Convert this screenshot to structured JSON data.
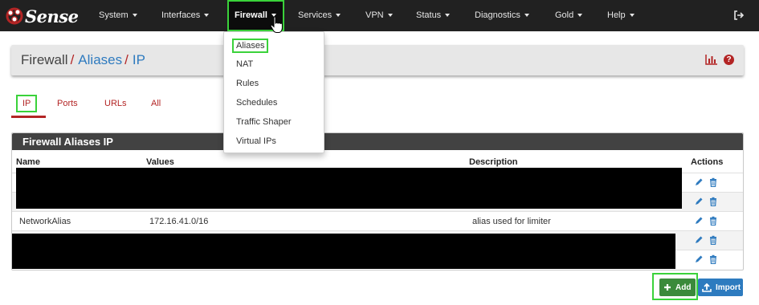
{
  "brand": {
    "name": "Sense",
    "logo_icon": "pfsense-gear-logo"
  },
  "nav": {
    "items": [
      {
        "label": "System"
      },
      {
        "label": "Interfaces"
      },
      {
        "label": "Firewall"
      },
      {
        "label": "Services"
      },
      {
        "label": "VPN"
      },
      {
        "label": "Status"
      },
      {
        "label": "Diagnostics"
      },
      {
        "label": "Gold"
      },
      {
        "label": "Help"
      }
    ],
    "active": "Firewall"
  },
  "dropdown": {
    "items": [
      {
        "label": "Aliases"
      },
      {
        "label": "NAT"
      },
      {
        "label": "Rules"
      },
      {
        "label": "Schedules"
      },
      {
        "label": "Traffic Shaper"
      },
      {
        "label": "Virtual IPs"
      }
    ]
  },
  "breadcrumb": {
    "root": "Firewall",
    "sep": "/",
    "level2": "Aliases",
    "level3": "IP"
  },
  "tabs": [
    {
      "label": "IP"
    },
    {
      "label": "Ports"
    },
    {
      "label": "URLs"
    },
    {
      "label": "All"
    }
  ],
  "panel": {
    "title": "Firewall Aliases IP",
    "columns": [
      "Name",
      "Values",
      "Description",
      "Actions"
    ],
    "rows": [
      {
        "name": "",
        "values": "",
        "description": ""
      },
      {
        "name": "",
        "values": "",
        "description": ""
      },
      {
        "name": "NetworkAlias",
        "values": "172.16.41.0/16",
        "description": "alias used for limiter"
      },
      {
        "name": "",
        "values": "",
        "description": ""
      },
      {
        "name": "",
        "values": "",
        "description": ""
      }
    ]
  },
  "buttons": {
    "add": "Add",
    "import": "Import"
  },
  "colors": {
    "navbar": "#212121",
    "accent_red": "#b32525",
    "link_blue": "#2f7bbf",
    "add_green": "#3b8a3b",
    "import_blue": "#2d7bbf",
    "highlight": "#3ad23a"
  }
}
